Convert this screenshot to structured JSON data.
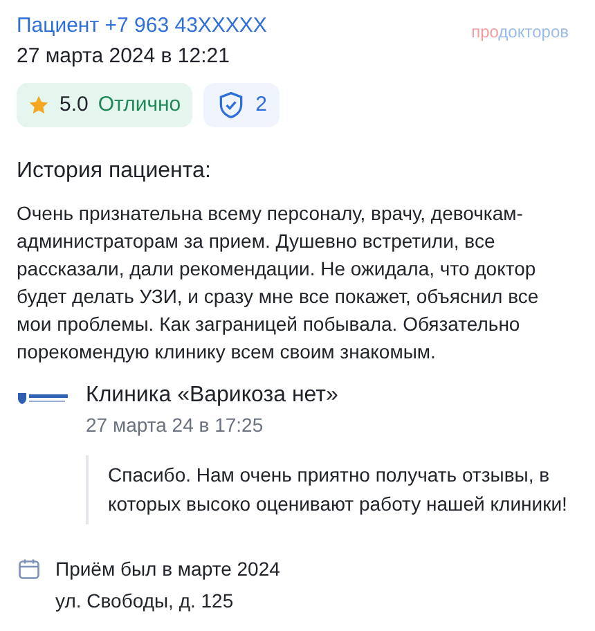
{
  "header": {
    "author": "Пациент +7 963 43XXXXX",
    "date": "27 марта 2024 в 12:21",
    "brand": {
      "part_1": "про",
      "part_2": "докторов"
    }
  },
  "rating": {
    "score": "5.0",
    "label": "Отлично"
  },
  "verified": {
    "count": "2"
  },
  "story": {
    "title": "История пациента:",
    "text": "Очень признательна всему персоналу, врачу, девочкам-администраторам за прием. Душевно встретили, все рассказали, дали рекомендации. Не ожидала, что доктор будет делать УЗИ, и сразу мне все покажет, объяснил все мои проблемы. Как заграницей побывала. Обязательно порекомендую клинику всем своим знакомым."
  },
  "reply": {
    "clinic": "Клиника «Варикоза нет»",
    "date": "27 марта 24 в 17:25",
    "text": "Спасибо. Нам очень приятно получать отзывы, в которых высоко оценивают работу нашей клиники!"
  },
  "visit": {
    "when": "Приём был в марте 2024",
    "address": "ул. Свободы, д. 125"
  }
}
